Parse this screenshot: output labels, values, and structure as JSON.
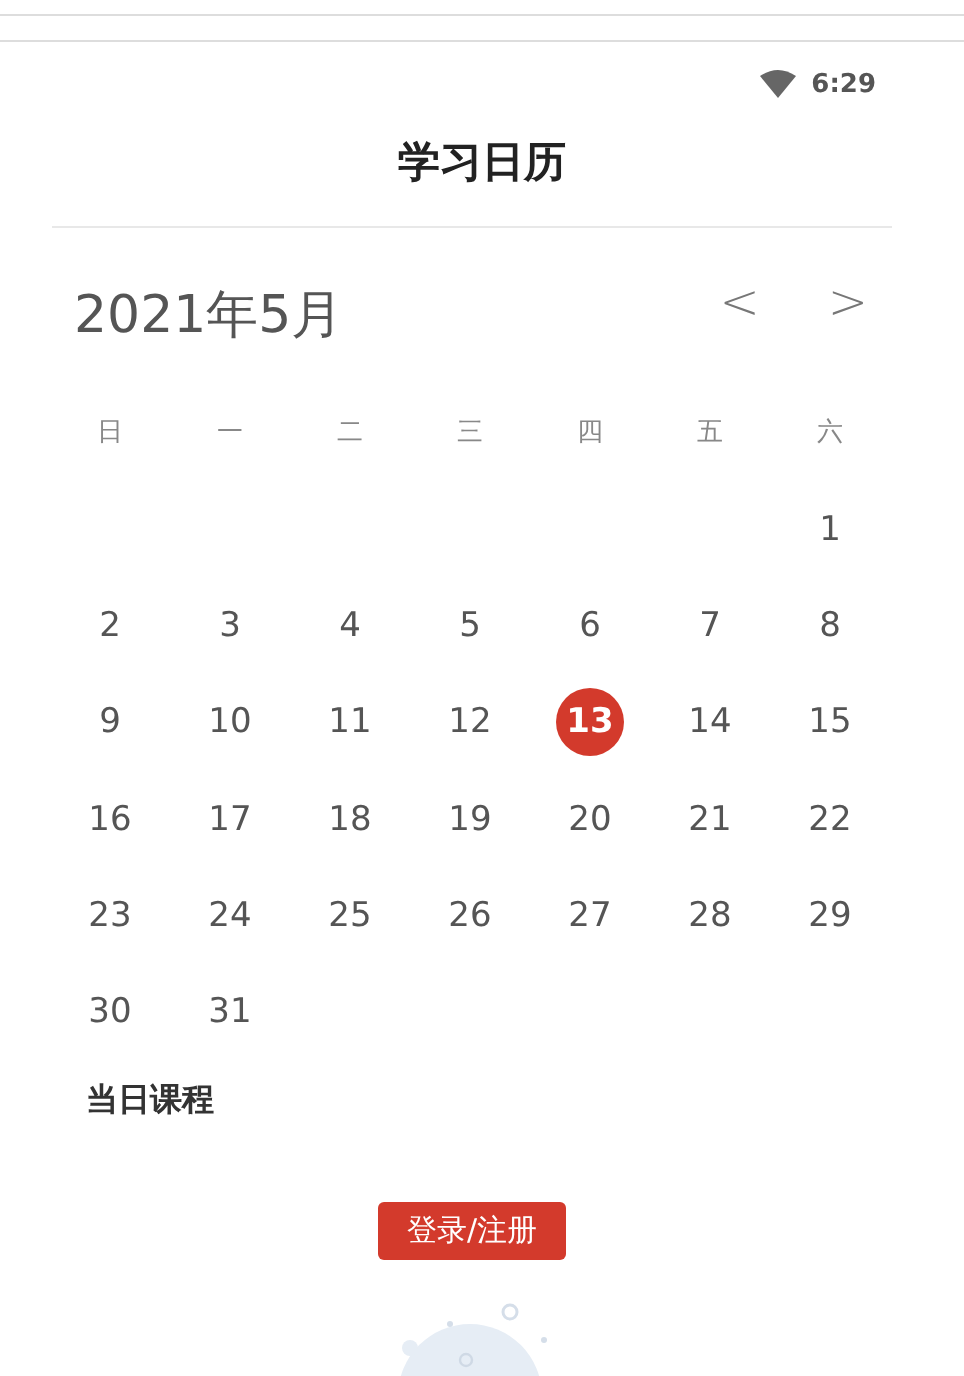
{
  "status_bar": {
    "time": "6:29"
  },
  "title": "学习日历",
  "calendar": {
    "month": "2021年5月",
    "prev": "<",
    "next": ">",
    "weekdays": [
      "日",
      "一",
      "二",
      "三",
      "四",
      "五",
      "六"
    ],
    "weeks": [
      [
        {
          "kind": "blank"
        },
        {
          "kind": "blank"
        },
        {
          "kind": "blank"
        },
        {
          "kind": "blank"
        },
        {
          "kind": "blank"
        },
        {
          "kind": "blank"
        },
        {
          "kind": "day",
          "day": "1",
          "selected": false
        }
      ],
      [
        {
          "kind": "day",
          "day": "2",
          "selected": false
        },
        {
          "kind": "day",
          "day": "3",
          "selected": false
        },
        {
          "kind": "day",
          "day": "4",
          "selected": false
        },
        {
          "kind": "day",
          "day": "5",
          "selected": false
        },
        {
          "kind": "day",
          "day": "6",
          "selected": false
        },
        {
          "kind": "day",
          "day": "7",
          "selected": false
        },
        {
          "kind": "day",
          "day": "8",
          "selected": false
        }
      ],
      [
        {
          "kind": "day",
          "day": "9",
          "selected": false
        },
        {
          "kind": "day",
          "day": "10",
          "selected": false
        },
        {
          "kind": "day",
          "day": "11",
          "selected": false
        },
        {
          "kind": "day",
          "day": "12",
          "selected": false
        },
        {
          "kind": "day",
          "day": "13",
          "selected": true
        },
        {
          "kind": "day",
          "day": "14",
          "selected": false
        },
        {
          "kind": "day",
          "day": "15",
          "selected": false
        }
      ],
      [
        {
          "kind": "day",
          "day": "16",
          "selected": false
        },
        {
          "kind": "day",
          "day": "17",
          "selected": false
        },
        {
          "kind": "day",
          "day": "18",
          "selected": false
        },
        {
          "kind": "day",
          "day": "19",
          "selected": false
        },
        {
          "kind": "day",
          "day": "20",
          "selected": false
        },
        {
          "kind": "day",
          "day": "21",
          "selected": false
        },
        {
          "kind": "day",
          "day": "22",
          "selected": false
        }
      ],
      [
        {
          "kind": "day",
          "day": "23",
          "selected": false
        },
        {
          "kind": "day",
          "day": "24",
          "selected": false
        },
        {
          "kind": "day",
          "day": "25",
          "selected": false
        },
        {
          "kind": "day",
          "day": "26",
          "selected": false
        },
        {
          "kind": "day",
          "day": "27",
          "selected": false
        },
        {
          "kind": "day",
          "day": "28",
          "selected": false
        },
        {
          "kind": "day",
          "day": "29",
          "selected": false
        }
      ],
      [
        {
          "kind": "day",
          "day": "30",
          "selected": false
        },
        {
          "kind": "day",
          "day": "31",
          "selected": false
        },
        {
          "kind": "blank"
        },
        {
          "kind": "blank"
        },
        {
          "kind": "blank"
        },
        {
          "kind": "blank"
        },
        {
          "kind": "blank"
        }
      ]
    ]
  },
  "courses": {
    "heading": "当日课程",
    "login_button": "登录/注册"
  }
}
